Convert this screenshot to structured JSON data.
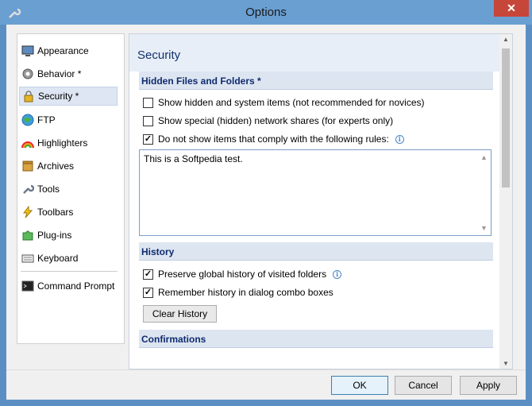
{
  "window": {
    "title": "Options"
  },
  "sidebar": {
    "items": [
      {
        "label": "Appearance",
        "icon": "monitor-icon"
      },
      {
        "label": "Behavior *",
        "icon": "gear-icon"
      },
      {
        "label": "Security *",
        "icon": "lock-icon",
        "selected": true
      },
      {
        "label": "FTP",
        "icon": "globe-icon"
      },
      {
        "label": "Highlighters",
        "icon": "rainbow-icon"
      },
      {
        "label": "Archives",
        "icon": "archive-icon"
      },
      {
        "label": "Tools",
        "icon": "wrench-icon"
      },
      {
        "label": "Toolbars",
        "icon": "lightning-icon"
      },
      {
        "label": "Plug-ins",
        "icon": "puzzle-icon"
      },
      {
        "label": "Keyboard",
        "icon": "keyboard-icon"
      },
      {
        "label": "Command Prompt",
        "icon": "terminal-icon"
      }
    ]
  },
  "panel": {
    "title": "Security",
    "sections": {
      "hidden": {
        "header": "Hidden Files and Folders *",
        "opt1": "Show hidden and system items (not recommended for novices)",
        "opt2": "Show special (hidden) network shares (for experts only)",
        "opt3": "Do not show items that comply with the following rules:",
        "rules_text": "This is a Softpedia test."
      },
      "history": {
        "header": "History",
        "opt1": "Preserve global history of visited folders",
        "opt2": "Remember history in dialog combo boxes",
        "clear_button": "Clear History"
      },
      "confirmations": {
        "header": "Confirmations"
      }
    }
  },
  "footer": {
    "ok": "OK",
    "cancel": "Cancel",
    "apply": "Apply"
  },
  "colors": {
    "titlebar": "#6a9fd2",
    "close": "#c7463a",
    "section_text": "#0f2b6e"
  }
}
